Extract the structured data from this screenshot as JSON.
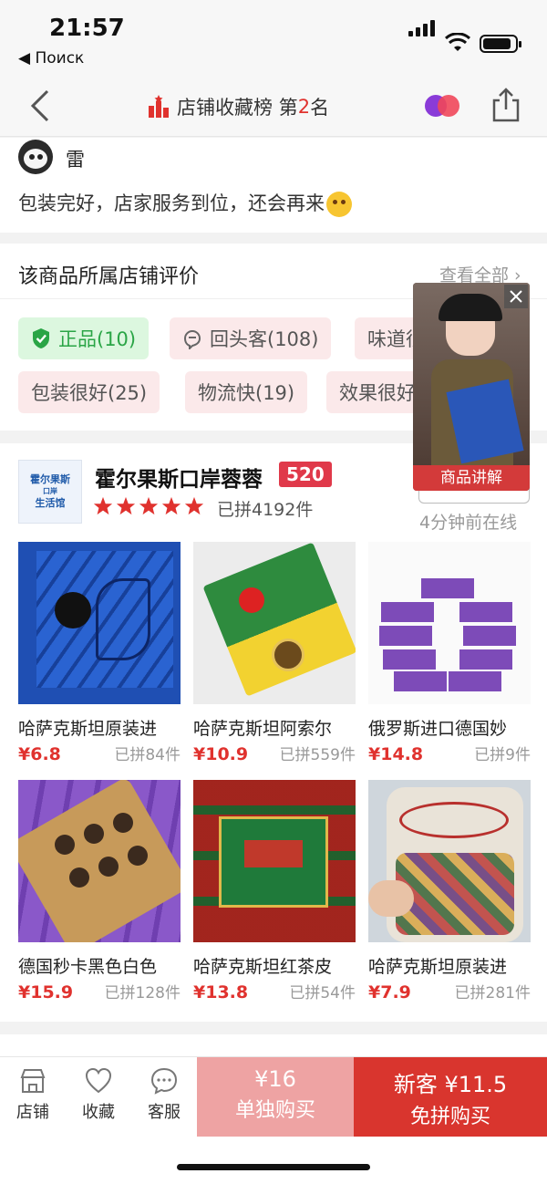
{
  "status": {
    "time": "21:57",
    "back_app": "◀ Поиск"
  },
  "nav": {
    "title_prefix": "店铺收藏榜 第",
    "rank": "2",
    "title_suffix": "名"
  },
  "review": {
    "reviewer": "雷",
    "text": "包装完好，店家服务到位，还会再来"
  },
  "store_reviews": {
    "title": "该商品所属店铺评价",
    "more": "查看全部 ›",
    "tags": [
      "正品(10)",
      "回头客(108)",
      "味道很好",
      "包装很好(25)",
      "物流快(19)",
      "效果很好"
    ]
  },
  "video": {
    "label": "商品讲解"
  },
  "shop": {
    "logo_lines": [
      "霍尔果斯",
      "口岸",
      "生活馆"
    ],
    "name": "霍尔果斯口岸蓉蓉",
    "badge": "520",
    "rating_stars": 5,
    "sold": "已拼4192件",
    "online": "4分钟前在线",
    "products": [
      {
        "name": "哈萨克斯坦原装进",
        "price": "¥6.8",
        "sold": "已拼84件"
      },
      {
        "name": "哈萨克斯坦阿索尔",
        "price": "¥10.9",
        "sold": "已拼559件"
      },
      {
        "name": "俄罗斯进口德国妙",
        "price": "¥14.8",
        "sold": "已拼9件"
      },
      {
        "name": "德国秒卡黑色白色",
        "price": "¥15.9",
        "sold": "已拼128件"
      },
      {
        "name": "哈萨克斯坦红茶皮",
        "price": "¥13.8",
        "sold": "已拼54件"
      },
      {
        "name": "哈萨克斯坦原装进",
        "price": "¥7.9",
        "sold": "已拼281件"
      }
    ]
  },
  "bottom": {
    "store": "店铺",
    "favorite": "收藏",
    "service": "客服",
    "single_price": "¥16",
    "single_label": "单独购买",
    "group_price": "新客 ¥11.5",
    "group_label": "免拼购买"
  },
  "colors": {
    "accent": "#d9352e",
    "price": "#e0322e",
    "tag_bg": "#fbe9ea",
    "tag_green": "#2aa546"
  }
}
